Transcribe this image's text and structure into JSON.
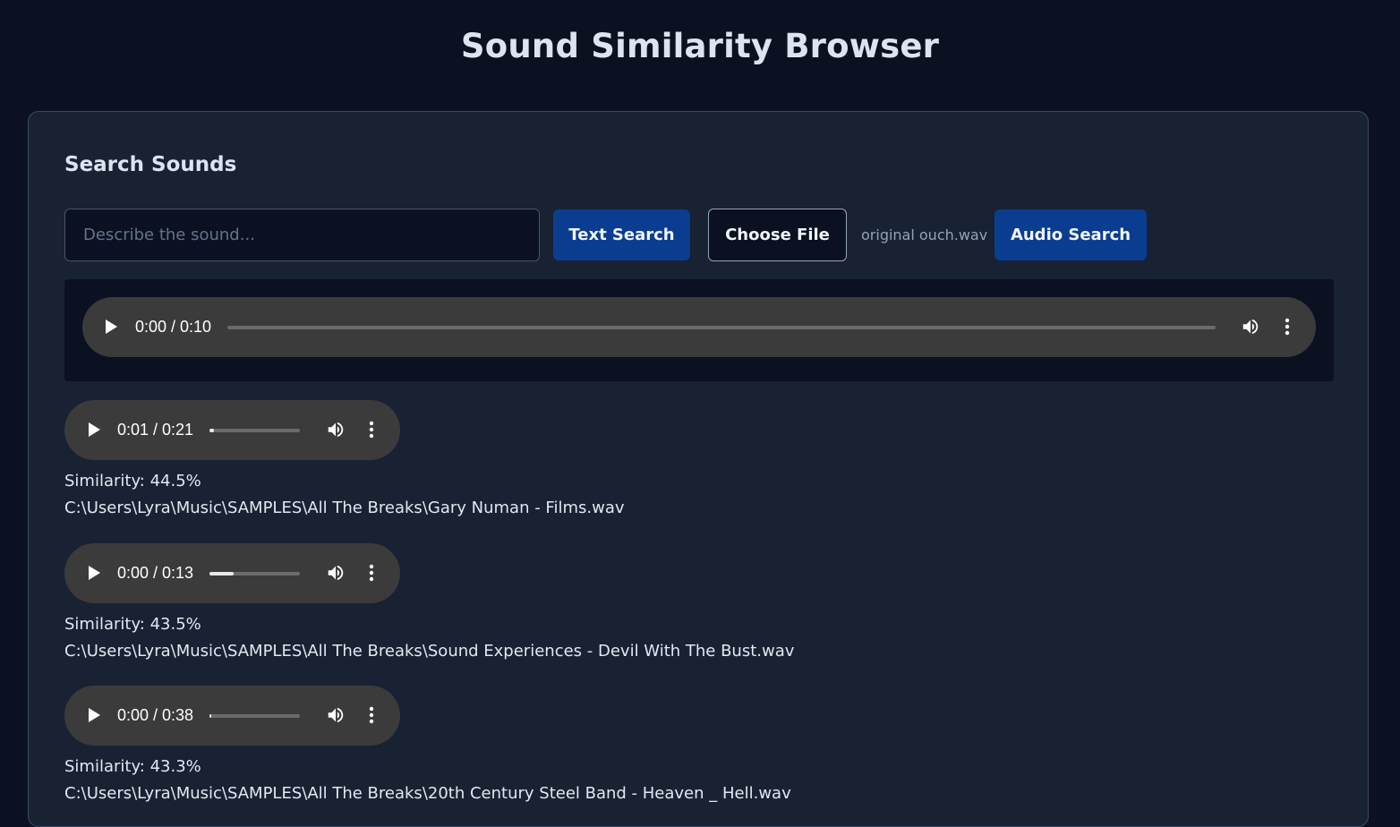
{
  "header": {
    "title": "Sound Similarity Browser"
  },
  "search": {
    "heading": "Search Sounds",
    "placeholder": "Describe the sound...",
    "value": "",
    "text_search_label": "Text Search",
    "choose_file_label": "Choose File",
    "selected_file": "original ouch.wav",
    "audio_search_label": "Audio Search"
  },
  "query_player": {
    "time": "0:00 / 0:10",
    "progress": 0.0
  },
  "results": [
    {
      "time": "0:01 / 0:21",
      "progress": 0.05,
      "similarity": "Similarity: 44.5%",
      "path": "C:\\Users\\Lyra\\Music\\SAMPLES\\All The Breaks\\Gary Numan - Films.wav"
    },
    {
      "time": "0:00 / 0:13",
      "progress": 0.27,
      "similarity": "Similarity: 43.5%",
      "path": "C:\\Users\\Lyra\\Music\\SAMPLES\\All The Breaks\\Sound Experiences - Devil With The Bust.wav"
    },
    {
      "time": "0:00 / 0:38",
      "progress": 0.02,
      "similarity": "Similarity: 43.3%",
      "path": "C:\\Users\\Lyra\\Music\\SAMPLES\\All The Breaks\\20th Century Steel Band - Heaven _ Hell.wav"
    }
  ],
  "icons": {
    "play": "play-icon",
    "volume": "volume-icon",
    "more": "more-options-icon"
  },
  "colors": {
    "background": "#0b1120",
    "panel": "#182232",
    "primary_button": "#0a3d8f",
    "player": "#3b3b3b"
  }
}
